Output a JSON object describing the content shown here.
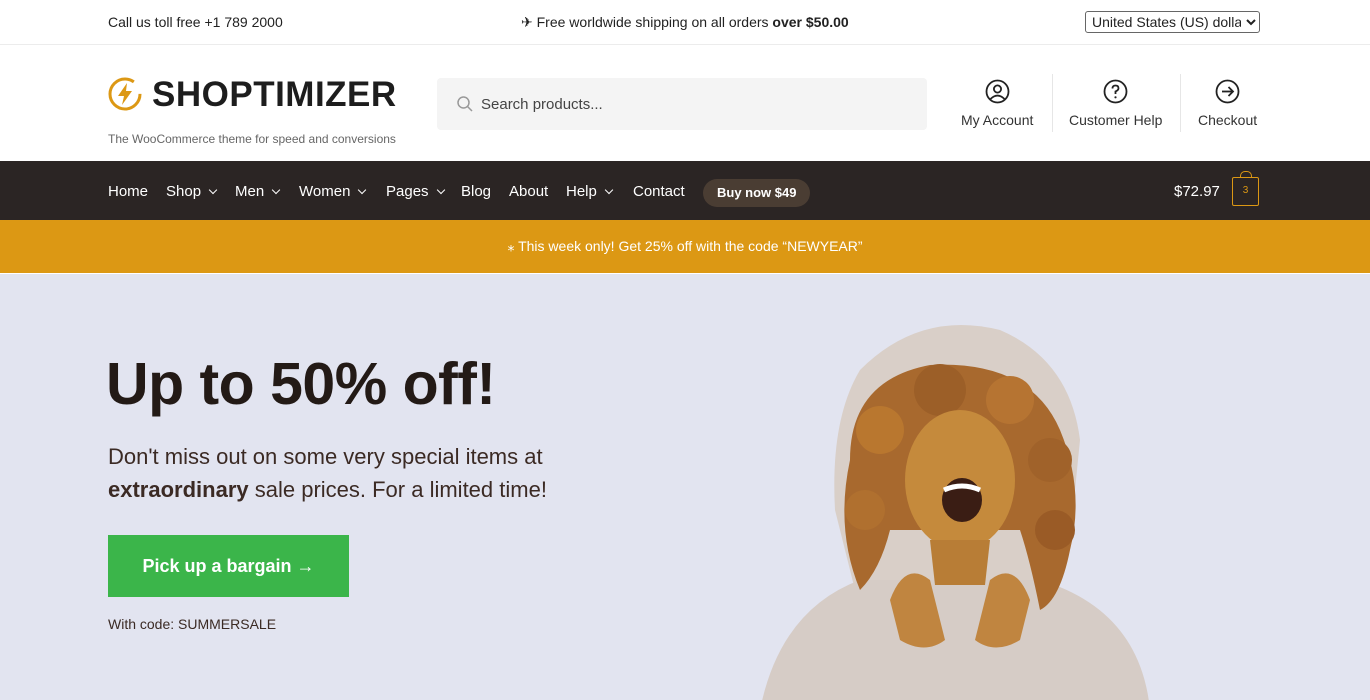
{
  "topbar": {
    "phone": "Call us toll free +1 789 2000",
    "shipping_prefix": "✈ Free worldwide shipping on all orders ",
    "shipping_bold": "over $50.00",
    "currency_selected": "United States (US) dollar"
  },
  "header": {
    "logo_name": "SHOPTIMIZER",
    "logo_tagline": "The WooCommerce theme for speed and conversions",
    "search_placeholder": "Search products...",
    "links": [
      {
        "label": "My Account",
        "icon": "user-icon"
      },
      {
        "label": "Customer Help",
        "icon": "help-icon"
      },
      {
        "label": "Checkout",
        "icon": "arrow-right-circle-icon"
      }
    ]
  },
  "nav": {
    "items": [
      "Home",
      "Shop",
      "Men",
      "Women",
      "Pages",
      "Blog",
      "About",
      "Help",
      "Contact"
    ],
    "buy_now": "Buy now $49",
    "cart_total": "$72.97",
    "cart_count": "3"
  },
  "promo": {
    "text": "⁎ This week only! Get 25% off with the code “NEWYEAR”"
  },
  "hero": {
    "title": "Up to 50% off!",
    "sub_line1": "Don't miss out on some very special items at",
    "sub_bold": "extraordinary",
    "sub_rest": " sale prices. For a limited time!",
    "cta": "Pick up a bargain →",
    "code": "With code: SUMMERSALE"
  },
  "colors": {
    "accent": "#dc9814",
    "nav_bg": "#2b2524",
    "hero_bg": "#e2e4f0",
    "cta_green": "#3bb54a"
  }
}
